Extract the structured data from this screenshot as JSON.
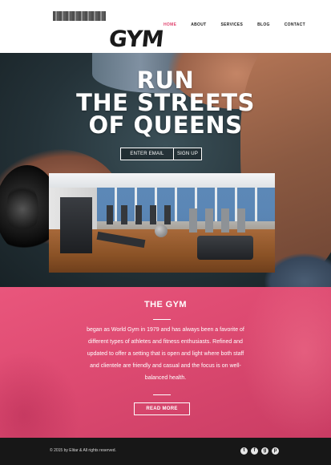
{
  "brand": {
    "logo_text": "GYM"
  },
  "nav": {
    "items": [
      {
        "label": "HOME",
        "active": true
      },
      {
        "label": "ABOUT",
        "active": false
      },
      {
        "label": "SERVICES",
        "active": false
      },
      {
        "label": "BLOG",
        "active": false
      },
      {
        "label": "CONTACT",
        "active": false
      }
    ]
  },
  "hero": {
    "title_lines": [
      "RUN",
      "THE STREETS",
      "OF QUEENS"
    ],
    "email_placeholder": "ENTER EMAIL",
    "signup_label": "SIGN UP"
  },
  "about": {
    "heading": "THE GYM",
    "body": "began as World Gym in 1979 and has always been a favorite of different types of athletes and fitness enthusiasts. Refined and updated to offer a setting that is open and light where both staff and clientele are friendly and casual and the focus is on well-balanced health.",
    "button_label": "READ MORE"
  },
  "footer": {
    "copyright": "© 2015 by Elitar & All rights reserved.",
    "social_icons": [
      "twitter-icon",
      "facebook-icon",
      "google-plus-icon",
      "pinterest-icon"
    ]
  },
  "colors": {
    "accent": "#e0426d",
    "about_bg": "#dd4a71",
    "footer_bg": "#171717"
  }
}
